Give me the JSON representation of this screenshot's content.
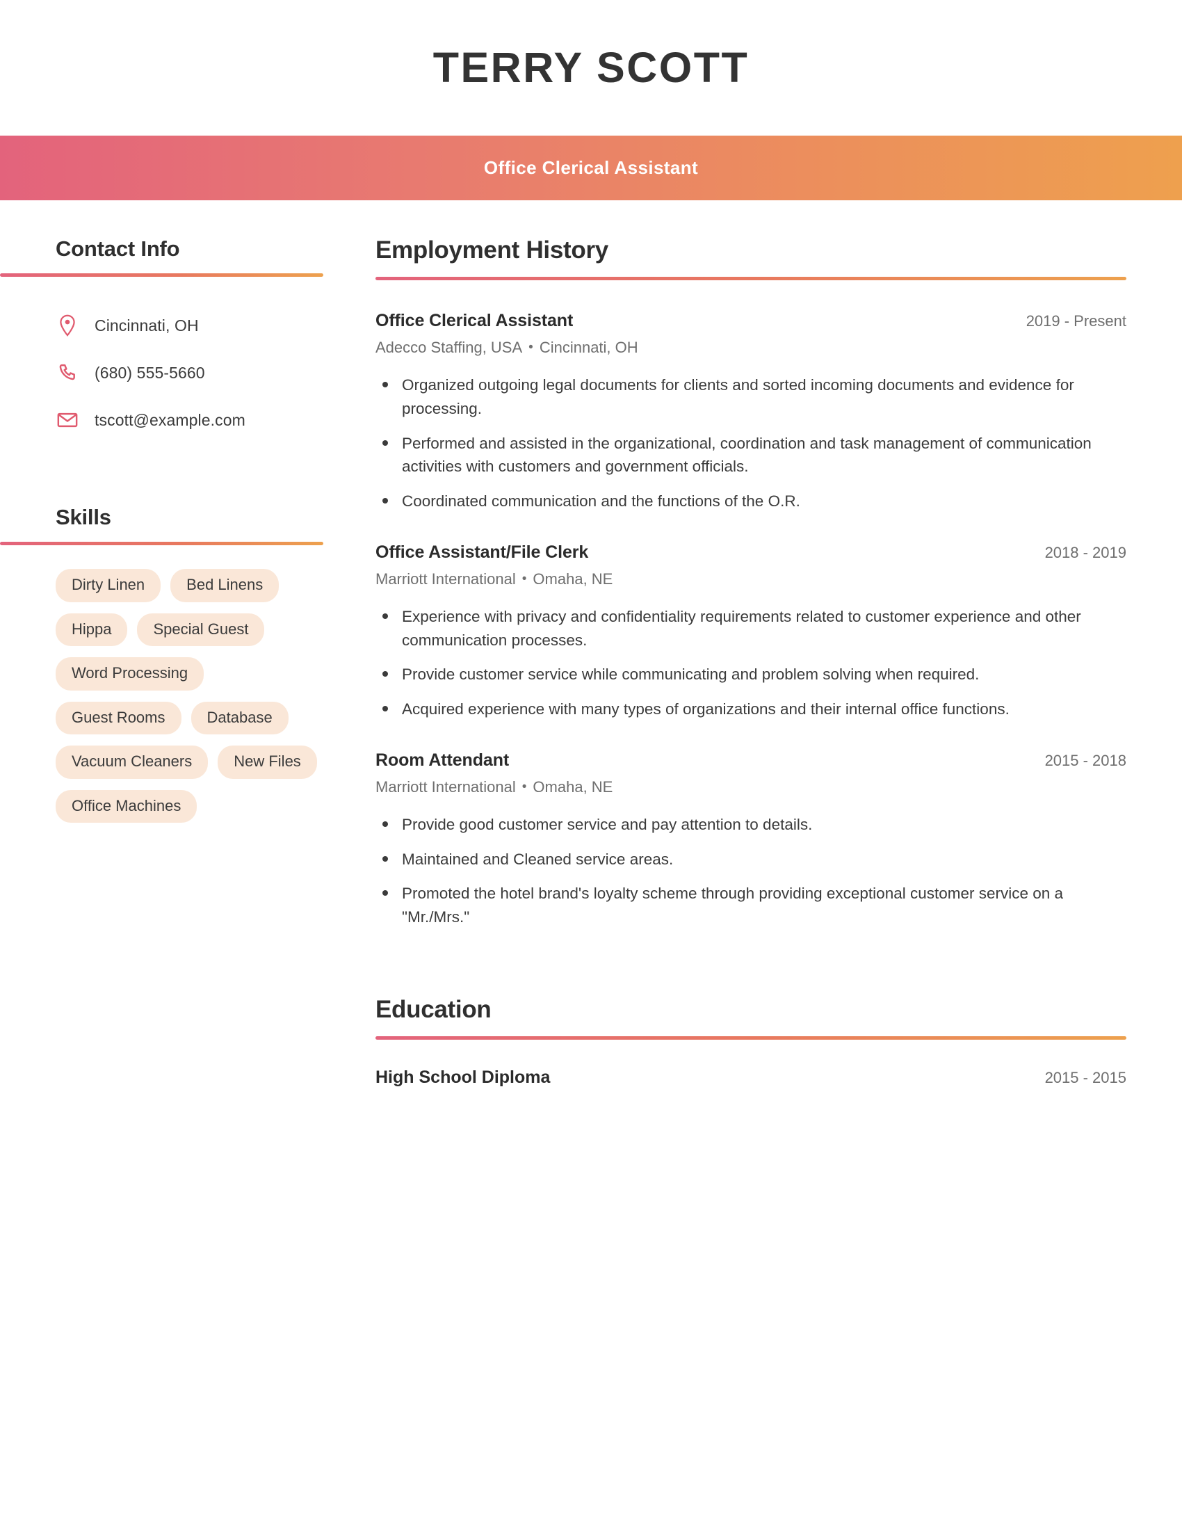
{
  "header": {
    "name": "TERRY SCOTT",
    "job_title": "Office Clerical Assistant"
  },
  "theme": {
    "gradient_start": "#e3637c",
    "gradient_end": "#eea04e",
    "icon_color": "#e05a6e",
    "pill_background": "#fae7d8",
    "heading_color": "#2f2f2f",
    "body_text_color": "#3b3b3b",
    "muted_text_color": "#6e6e6e"
  },
  "sidebar": {
    "contact": {
      "heading": "Contact Info",
      "items": [
        {
          "icon": "location-pin-icon",
          "text": "Cincinnati, OH"
        },
        {
          "icon": "phone-icon",
          "text": "(680) 555-5660"
        },
        {
          "icon": "envelope-icon",
          "text": "tscott@example.com"
        }
      ]
    },
    "skills": {
      "heading": "Skills",
      "items": [
        "Dirty Linen",
        "Bed Linens",
        "Hippa",
        "Special Guest",
        "Word Processing",
        "Guest Rooms",
        "Database",
        "Vacuum Cleaners",
        "New Files",
        "Office Machines"
      ]
    }
  },
  "main": {
    "employment": {
      "heading": "Employment History",
      "jobs": [
        {
          "title": "Office Clerical Assistant",
          "dates": "2019 - Present",
          "company": "Adecco Staffing, USA",
          "location": "Cincinnati, OH",
          "bullets": [
            "Organized outgoing legal documents for clients and sorted incoming documents and evidence for processing.",
            "Performed and assisted in the organizational, coordination and task management of communication activities with customers and government officials.",
            "Coordinated communication and the functions of the O.R."
          ]
        },
        {
          "title": "Office Assistant/File Clerk",
          "dates": "2018 - 2019",
          "company": "Marriott International",
          "location": "Omaha, NE",
          "bullets": [
            "Experience with privacy and confidentiality requirements related to customer experience and other communication processes.",
            "Provide customer service while communicating and problem solving when required.",
            "Acquired experience with many types of organizations and their internal office functions."
          ]
        },
        {
          "title": "Room Attendant",
          "dates": "2015 - 2018",
          "company": "Marriott International",
          "location": "Omaha, NE",
          "bullets": [
            "Provide good customer service and pay attention to details.",
            "Maintained and Cleaned service areas.",
            "Promoted the hotel brand's loyalty scheme through providing exceptional customer service on a \"Mr./Mrs.\""
          ]
        }
      ]
    },
    "education": {
      "heading": "Education",
      "entries": [
        {
          "degree": "High School Diploma",
          "dates": "2015 - 2015"
        }
      ]
    }
  },
  "separator": "•"
}
